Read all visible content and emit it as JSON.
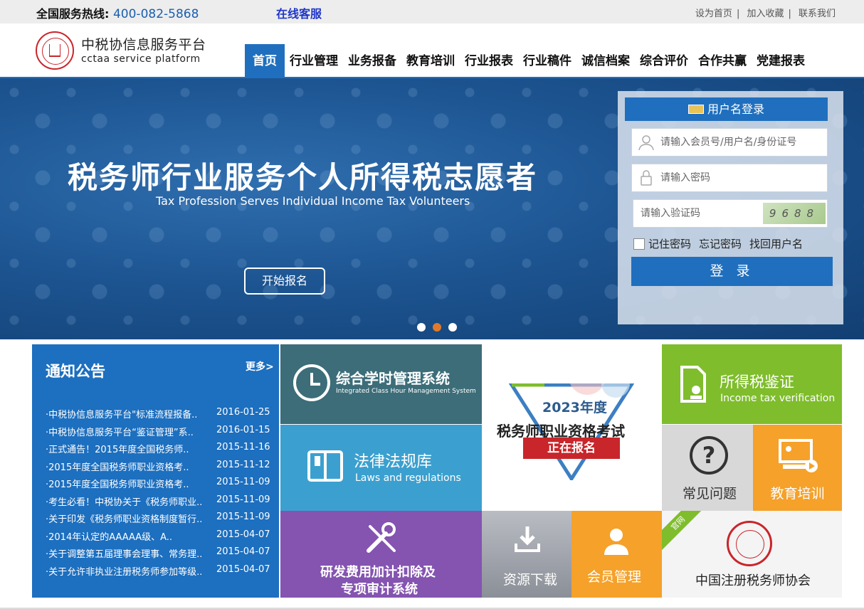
{
  "topbar": {
    "hotline_label": "全国服务热线:",
    "hotline_number": "400-082-5868",
    "online_service": "在线客服",
    "links": [
      "设为首页",
      "加入收藏",
      "联系我们"
    ]
  },
  "logo": {
    "cn": "中税协信息服务平台",
    "en": "cctaa  service platform"
  },
  "nav": [
    "首页",
    "行业管理",
    "业务报备",
    "教育培训",
    "行业报表",
    "行业稿件",
    "诚信档案",
    "综合评价",
    "合作共赢",
    "党建报表"
  ],
  "banner": {
    "title": "税务师行业服务个人所得税志愿者",
    "subtitle": "Tax Profession Serves Individual Income Tax Volunteers",
    "button": "开始报名"
  },
  "login": {
    "header": "用户名登录",
    "user_placeholder": "请输入会员号/用户名/身份证号",
    "password_placeholder": "请输入密码",
    "code_placeholder": "请输入验证码",
    "captcha": "9688",
    "remember": "记住密码",
    "forgot": "忘记密码",
    "find_user": "找回用户名",
    "submit": "登 录"
  },
  "notice": {
    "title": "通知公告",
    "more": "更多>",
    "items": [
      {
        "title": "·中税协信息服务平台\"标准流程报备..",
        "date": "2016-01-25"
      },
      {
        "title": "·中税协信息服务平台“鉴证管理”系..",
        "date": "2016-01-15"
      },
      {
        "title": "·正式通告！2015年度全国税务师..",
        "date": "2015-11-16"
      },
      {
        "title": "·2015年度全国税务师职业资格考..",
        "date": "2015-11-12"
      },
      {
        "title": "·2015年度全国税务师职业资格考..",
        "date": "2015-11-09"
      },
      {
        "title": "·考生必看！中税协关于《税务师职业..",
        "date": "2015-11-09"
      },
      {
        "title": "·关于印发《税务师职业资格制度暂行..",
        "date": "2015-11-09"
      },
      {
        "title": "·2014年认定的AAAAA级、A..",
        "date": "2015-04-07"
      },
      {
        "title": "·关于调整第五届理事会理事、常务理..",
        "date": "2015-04-07"
      },
      {
        "title": "·关于允许非执业注册税务师参加等级..",
        "date": "2015-04-07"
      }
    ]
  },
  "tiles": {
    "study": {
      "cn": "综合学时管理系统",
      "en": "Integrated Class Hour Management System"
    },
    "law": {
      "cn": "法律法规库",
      "en": "Laws and regulations"
    },
    "rd": {
      "line1": "研发费用加计扣除及",
      "line2": "专项审计系统"
    },
    "exam": {
      "year": "2023年度",
      "title": "税务师职业资格考试",
      "badge": "正在报名"
    },
    "download": "资源下载",
    "member": "会员管理",
    "tax": {
      "cn": "所得税鉴证",
      "en": "Income tax verification"
    },
    "faq": "常见问题",
    "edu": "教育培训",
    "assoc": {
      "corner": "官网",
      "name": "中国注册税务师协会"
    }
  },
  "colors": {
    "primary": "#1f6fbe",
    "green": "#7fbd2c",
    "orange": "#f5a12a",
    "purple": "#8454b0",
    "red": "#c8262b"
  }
}
